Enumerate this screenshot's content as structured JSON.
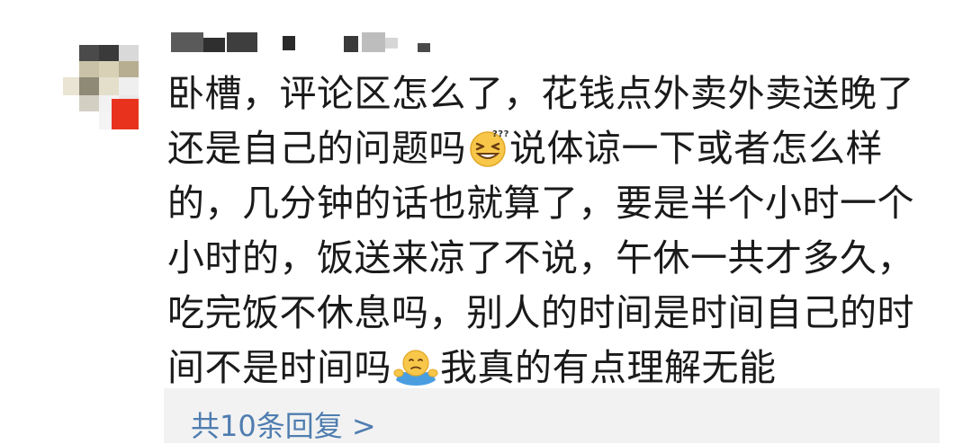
{
  "user": {
    "avatar_icon": "avatar-pixelated-icon",
    "name_censored": true
  },
  "comment": {
    "seg1": "卧槽，评论区怎么了，花钱点外卖外卖送晚了还是自己的问题吗",
    "emoji1": "squinting-smile-emoji",
    "seg2": "说体谅一下或者怎么样的，几分钟的话也就算了，要是半个小时一个小时的，饭送来凉了不说，午休一共才多久，吃完饭不休息吗，别人的时间是时间自己的时间不是时间吗",
    "emoji2": "shrug-emoji",
    "seg3": "我真的有点理解无能"
  },
  "replies": {
    "label": "共10条回复 >"
  },
  "colors": {
    "text": "#1a1a1a",
    "link": "#4f7db0",
    "reply_bg": "#f2f2f2"
  }
}
